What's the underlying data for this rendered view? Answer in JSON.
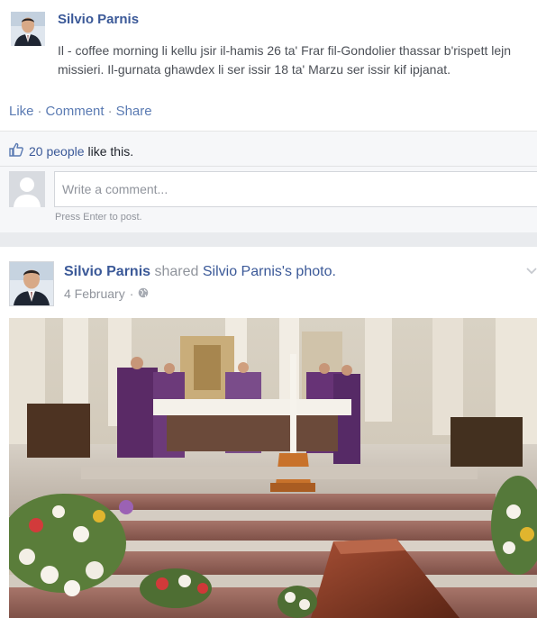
{
  "post1": {
    "author": "Silvio Parnis",
    "text": "Il - coffee morning li kellu jsir il-hamis 26 ta' Frar fil-Gondolier thassar b'rispett lejn missieri. Il-gurnata ghawdex li ser issir 18 ta' Marzu ser issir kif ipjanat.",
    "actions": {
      "like": "Like",
      "comment": "Comment",
      "share": "Share",
      "separator": "·"
    },
    "likes": {
      "icon": "thumbs-up-icon",
      "count": "20 people",
      "suffix": "like this."
    },
    "comment_box": {
      "placeholder": "Write a comment...",
      "hint": "Press Enter to post."
    }
  },
  "post2": {
    "author": "Silvio Parnis",
    "verb": "shared",
    "owner": "Silvio Parnis",
    "owner_suffix": "'s",
    "object": "photo.",
    "date": "4 February",
    "date_separator": "·",
    "privacy_icon": "globe-icon",
    "menu_icon": "chevron-down-icon",
    "photo_description": "church-altar-funeral-photo"
  },
  "colors": {
    "link": "#3b5998",
    "action": "#5b7bb3",
    "muted": "#90949c",
    "background": "#e9ebee"
  }
}
